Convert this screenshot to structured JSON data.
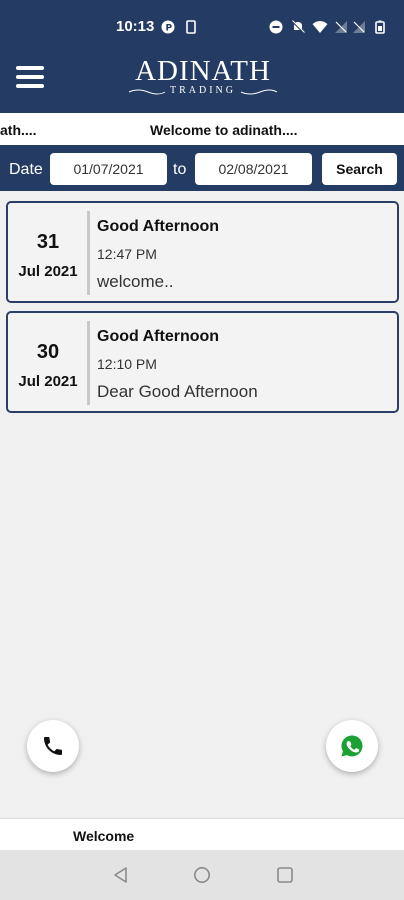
{
  "status": {
    "time": "10:13"
  },
  "header": {
    "logo_main": "ADINATH",
    "logo_sub": "TRADING"
  },
  "marquee": {
    "text_left": "ath....",
    "text_main": "Welcome to adinath...."
  },
  "filter": {
    "date_label": "Date",
    "from_value": "01/07/2021",
    "to_label": "to",
    "to_value": "02/08/2021",
    "search_label": "Search"
  },
  "notifications": [
    {
      "day": "31",
      "month_year": "Jul 2021",
      "title": "Good Afternoon",
      "time": "12:47 PM",
      "message": "welcome.."
    },
    {
      "day": "30",
      "month_year": "Jul 2021",
      "title": "Good Afternoon",
      "time": "12:10 PM",
      "message": "Dear Good Afternoon"
    }
  ],
  "bottom": {
    "label": "Welcome"
  },
  "colors": {
    "brand": "#243b63",
    "whatsapp": "#1aa033"
  }
}
